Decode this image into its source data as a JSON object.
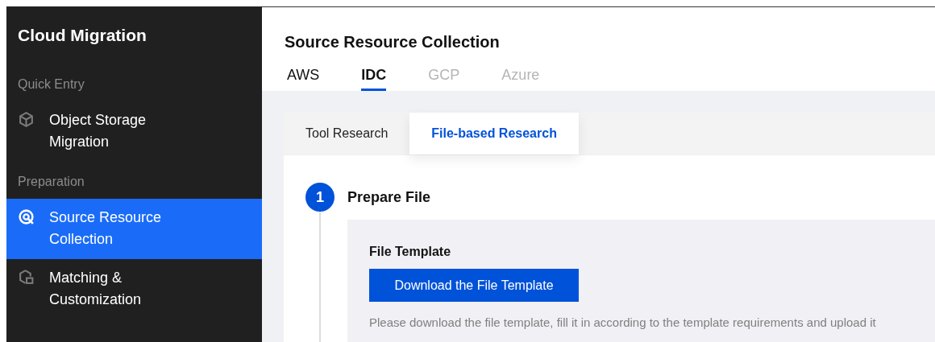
{
  "sidebar": {
    "title": "Cloud Migration",
    "items": [
      {
        "kind": "section",
        "label": "Quick Entry"
      },
      {
        "kind": "item",
        "label": "Object Storage Migration",
        "selected": false
      },
      {
        "kind": "section",
        "label": "Preparation"
      },
      {
        "kind": "item",
        "label": "Source Resource Collection",
        "selected": true
      },
      {
        "kind": "item",
        "label": "Matching & Customization",
        "selected": false
      }
    ]
  },
  "page": {
    "title": "Source Resource Collection",
    "tabs": [
      {
        "label": "AWS",
        "selected": false,
        "disabled": false
      },
      {
        "label": "IDC",
        "selected": true,
        "disabled": false
      },
      {
        "label": "GCP",
        "selected": false,
        "disabled": true
      },
      {
        "label": "Azure",
        "selected": false,
        "disabled": true
      }
    ]
  },
  "card": {
    "tabs": [
      {
        "label": "Tool Research",
        "selected": false
      },
      {
        "label": "File-based Research",
        "selected": true
      }
    ],
    "steps": [
      {
        "number": "1",
        "title": "Prepare File",
        "section_title": "File Template",
        "button": "Download the File Template",
        "description": "Please download the file template, fill it in according to the template requirements and upload it"
      }
    ]
  }
}
